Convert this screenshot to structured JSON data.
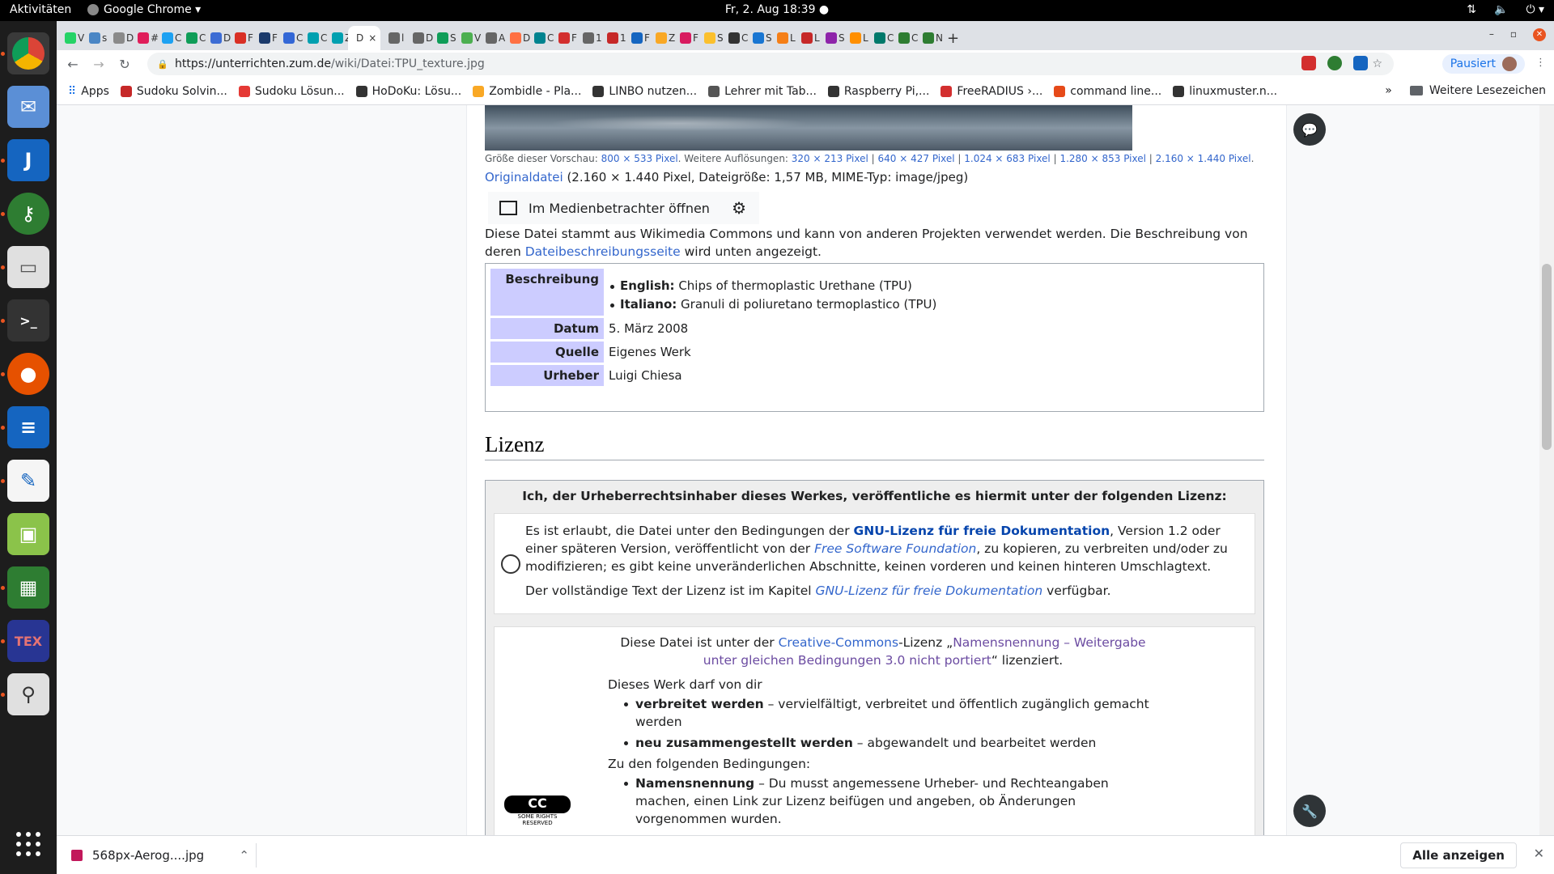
{
  "topbar": {
    "activities": "Aktivitäten",
    "app_name": "Google Chrome ▾",
    "clock": "Fr, 2. Aug  18:39 ●"
  },
  "tabs": [
    {
      "label": "V",
      "color": "#25d366"
    },
    {
      "label": "s",
      "color": "#4a86c5"
    },
    {
      "label": "D",
      "color": "#8a8a8a"
    },
    {
      "label": "#",
      "color": "#e01e5a"
    },
    {
      "label": "C",
      "color": "#1da1f2"
    },
    {
      "label": "C",
      "color": "#0f9d58"
    },
    {
      "label": "D",
      "color": "#3c6cd4"
    },
    {
      "label": "F",
      "color": "#d93025"
    },
    {
      "label": "F",
      "color": "#1b3a6b"
    },
    {
      "label": "C",
      "color": "#3367d6"
    },
    {
      "label": "C",
      "color": "#00a0b0"
    },
    {
      "label": "Z",
      "color": "#00a0b0"
    },
    {
      "label": "D",
      "color": "#ffffff",
      "active": true
    },
    {
      "label": "l",
      "color": "#666"
    },
    {
      "label": "D",
      "color": "#666"
    },
    {
      "label": "S",
      "color": "#0f9d58"
    },
    {
      "label": "V",
      "color": "#4caf50"
    },
    {
      "label": "A",
      "color": "#666"
    },
    {
      "label": "D",
      "color": "#ff7043"
    },
    {
      "label": "C",
      "color": "#00838f"
    },
    {
      "label": "F",
      "color": "#d32f2f"
    },
    {
      "label": "1",
      "color": "#666"
    },
    {
      "label": "1",
      "color": "#c62828"
    },
    {
      "label": "F",
      "color": "#1565c0"
    },
    {
      "label": "Z",
      "color": "#f9a825"
    },
    {
      "label": "F",
      "color": "#d81b60"
    },
    {
      "label": "S",
      "color": "#fbc02d"
    },
    {
      "label": "C",
      "color": "#333"
    },
    {
      "label": "S",
      "color": "#1976d2"
    },
    {
      "label": "L",
      "color": "#f57f17"
    },
    {
      "label": "L",
      "color": "#c62828"
    },
    {
      "label": "S",
      "color": "#8e24aa"
    },
    {
      "label": "L",
      "color": "#ff8f00"
    },
    {
      "label": "C",
      "color": "#00796b"
    },
    {
      "label": "C",
      "color": "#2e7d32"
    },
    {
      "label": "N",
      "color": "#2e7d32"
    }
  ],
  "new_tab": "+",
  "window_controls": {
    "minimize": "–",
    "restore": "▫",
    "close": "✕"
  },
  "toolbar": {
    "back": "←",
    "forward": "→",
    "reload": "↻",
    "url_host": "https://unterrichten.zum.de",
    "url_path": "/wiki/Datei:TPU_texture.jpg",
    "paused": "Pausiert",
    "avatar": "r",
    "menu": "⋮"
  },
  "bookmarks": {
    "apps": "Apps",
    "items": [
      {
        "label": "Sudoku Solvin...",
        "color": "#c62828"
      },
      {
        "label": "Sudoku Lösun...",
        "color": "#e53935"
      },
      {
        "label": "HoDoKu: Lösu...",
        "color": "#333"
      },
      {
        "label": "Zombidle - Pla...",
        "color": "#f9a825"
      },
      {
        "label": "LINBO nutzen...",
        "color": "#333"
      },
      {
        "label": "Lehrer mit Tab...",
        "color": "#555"
      },
      {
        "label": "Raspberry Pi,...",
        "color": "#333"
      },
      {
        "label": "FreeRADIUS ›...",
        "color": "#d32f2f"
      },
      {
        "label": "command line...",
        "color": "#e64a19"
      },
      {
        "label": "linuxmuster.n...",
        "color": "#333"
      }
    ],
    "more": "»",
    "other": "Weitere Lesezeichen"
  },
  "page": {
    "sizes_prefix": "Größe dieser Vorschau: ",
    "preview_size": "800 × 533 Pixel",
    "other_res": ". Weitere Auflösungen: ",
    "res1": "320 × 213 Pixel",
    "res2": "640 × 427 Pixel",
    "res3": "1.024 × 683 Pixel",
    "res4": "1.280 × 853 Pixel",
    "res5": "2.160 × 1.440 Pixel",
    "sep": " | ",
    "dot": ".",
    "orig_link": "Originaldatei",
    "orig_info": " (2.160 × 1.440 Pixel, Dateigröße: 1,57 MB, MIME-Typ: image/jpeg)",
    "media_button": "Im Medienbetrachter öffnen",
    "commons_text": "Diese Datei stammt aus Wikimedia Commons und kann von anderen Projekten verwendet werden. Die Beschreibung von deren ",
    "commons_link": "Dateibeschreibungsseite",
    "commons_tail": " wird unten angezeigt.",
    "info": {
      "desc_label": "Beschreibung",
      "desc_en_lang": "English:",
      "desc_en": " Chips of thermoplastic Urethane (TPU)",
      "desc_it_lang": "Italiano:",
      "desc_it": " Granuli di poliuretano termoplastico (TPU)",
      "date_label": "Datum",
      "date": "5. März 2008",
      "source_label": "Quelle",
      "source": "Eigenes Werk",
      "author_label": "Urheber",
      "author": "Luigi Chiesa"
    },
    "license_heading": "Lizenz",
    "license_head": "Ich, der Urheberrechtsinhaber dieses Werkes, veröffentliche es hiermit unter der folgenden Lizenz:",
    "gfdl": {
      "p1a": "Es ist erlaubt, die Datei unter den Bedingungen der ",
      "p1link": "GNU-Lizenz für freie Dokumentation",
      "p1b": ", Version 1.2 oder einer späteren Version, veröffentlicht von der ",
      "p1fsf": "Free Software Foundation",
      "p1c": ", zu kopieren, zu verbreiten und/oder zu modifizieren; es gibt keine unveränderlichen Abschnitte, keinen vorderen und keinen hinteren Umschlagtext.",
      "p2a": "Der vollständige Text der Lizenz ist im Kapitel ",
      "p2link": "GNU-Lizenz für freie Dokumentation",
      "p2b": " verfügbar."
    },
    "cc": {
      "l1a": "Diese Datei ist unter der ",
      "l1link": "Creative-Commons",
      "l1b": "-Lizenz „",
      "l1name": "Namensnennung – Weitergabe unter gleichen Bedingungen 3.0 nicht portiert",
      "l1c": "“ lizenziert.",
      "may": "Dieses Werk darf von dir",
      "b1": "verbreitet werden",
      "b1t": " – vervielfältigt, verbreitet und öffentlich zugänglich gemacht werden",
      "b2": "neu zusammengestellt werden",
      "b2t": " – abgewandelt und bearbeitet werden",
      "cond": "Zu den folgenden Bedingungen:",
      "c1": "Namensnennung",
      "c1t": " – Du musst angemessene Urheber- und Rechteangaben machen, einen Link zur Lizenz beifügen und angeben, ob Änderungen vorgenommen wurden.",
      "logo": "CC",
      "logo_sub": "SOME RIGHTS RESERVED"
    }
  },
  "download": {
    "file": "568px-Aerog....jpg",
    "show_all": "Alle anzeigen",
    "close": "✕"
  }
}
